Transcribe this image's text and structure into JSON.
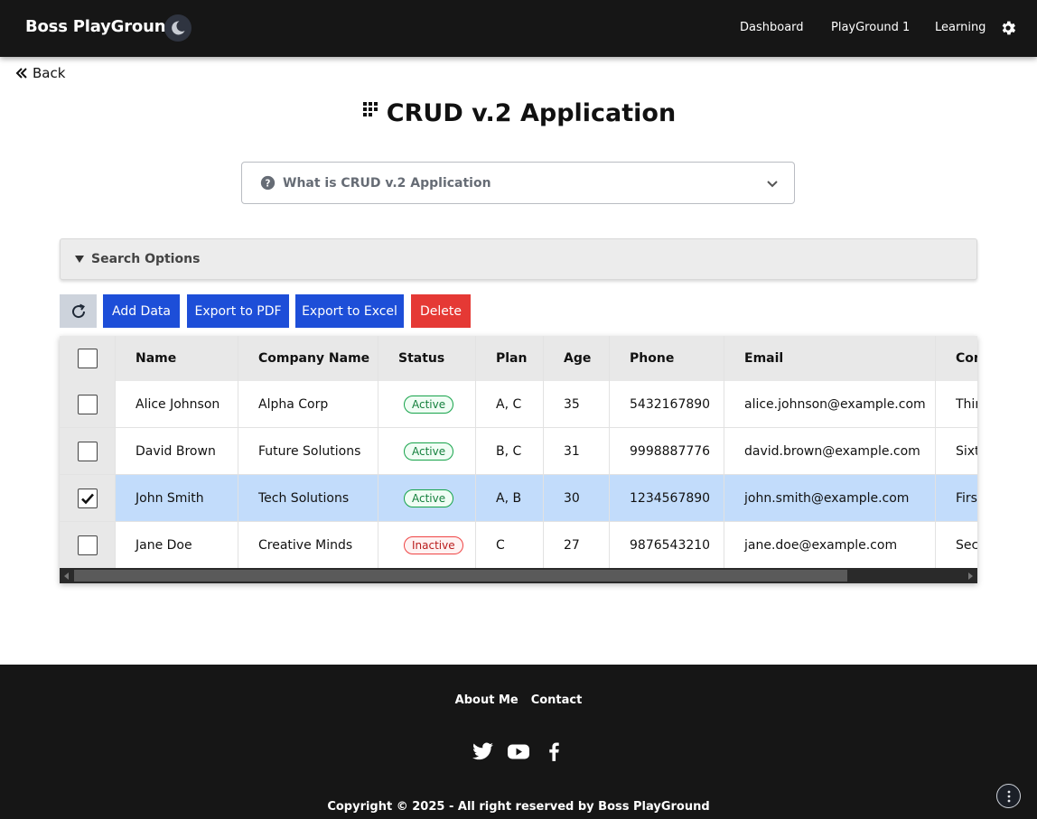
{
  "header": {
    "brand": "Boss PlayGround",
    "nav": [
      "Dashboard",
      "PlayGround 1",
      "Learning"
    ]
  },
  "back": {
    "label": "Back"
  },
  "page": {
    "title": "CRUD v.2 Application",
    "accordion_label": "What is CRUD v.2 Application",
    "search_options_label": "Search Options"
  },
  "toolbar": {
    "add_label": "Add Data",
    "export_pdf_label": "Export to PDF",
    "export_excel_label": "Export to Excel",
    "delete_label": "Delete"
  },
  "table": {
    "columns": [
      "Name",
      "Company Name",
      "Status",
      "Plan",
      "Age",
      "Phone",
      "Email",
      "Con"
    ],
    "rows": [
      {
        "name": "Alice Johnson",
        "company": "Alpha Corp",
        "status": "Active",
        "plan": "A, C",
        "age": "35",
        "phone": "5432167890",
        "email": "alice.johnson@example.com",
        "extra": "Thir",
        "checked": false
      },
      {
        "name": "David Brown",
        "company": "Future Solutions",
        "status": "Active",
        "plan": "B, C",
        "age": "31",
        "phone": "9998887776",
        "email": "david.brown@example.com",
        "extra": "Sixt",
        "checked": false
      },
      {
        "name": "John Smith",
        "company": "Tech Solutions",
        "status": "Active",
        "plan": "A, B",
        "age": "30",
        "phone": "1234567890",
        "email": "john.smith@example.com",
        "extra": "First",
        "checked": true
      },
      {
        "name": "Jane Doe",
        "company": "Creative Minds",
        "status": "Inactive",
        "plan": "C",
        "age": "27",
        "phone": "9876543210",
        "email": "jane.doe@example.com",
        "extra": "Sec",
        "checked": false
      }
    ]
  },
  "footer": {
    "links": [
      "About Me",
      "Contact"
    ],
    "socials": [
      "twitter-icon",
      "youtube-icon",
      "facebook-icon"
    ],
    "copyright": "Copyright © 2025 - All right reserved by Boss PlayGround"
  },
  "colors": {
    "primary_button": "#1d4ed8",
    "danger_button": "#e53935",
    "selected_row": "#c2dcfb",
    "navbar_bg": "#161616"
  }
}
